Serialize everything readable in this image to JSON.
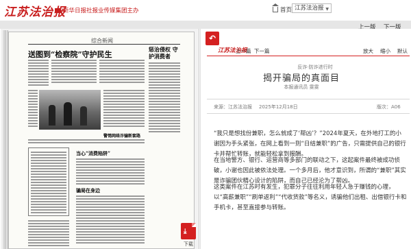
{
  "brand": {
    "logo": "江苏法治报",
    "tagline": "新华日报社报业传媒集团主办"
  },
  "header": {
    "home_label": "首页",
    "edition_value": "江苏法治报"
  },
  "pager": {
    "prev_label": "上一版",
    "next_label": "下一版"
  },
  "newspaper": {
    "page_tag": "综合新闻",
    "headline_main": "送图到“检察院”守护民生",
    "headline_right": "惩治侵权 守护消费者",
    "headline_mid": "当心“消费陷阱”",
    "headline_low": "警惕网络诈骗新套路",
    "headline_bottom": "骗局在身边"
  },
  "pdf": {
    "icon": "pdf-icon",
    "label": "下载"
  },
  "article": {
    "back_icon": "back-arrow-icon",
    "logo": "江苏法治报",
    "nav_prev": "上一篇",
    "nav_next": "下一篇",
    "font_enlarge": "放大",
    "font_shrink": "缩小",
    "font_default": "默认",
    "kicker": "反诈·防诈进行时",
    "title": "揭开骗局的真面目",
    "byline": "本报通讯员 雯雯",
    "source": "来源：江苏法治报",
    "date": "2025年12月18日",
    "page": "版次：A06",
    "paragraphs": [
      "“我只是想找份兼职，怎么就成了‘帮凶’？”2024年夏天，在外地打工的小谢因为手头紧张，在网上看到一则“日结兼职”的广告，只需提供自己的银行卡并帮忙转账，就能轻松拿到报酬。",
      "在当地警方、银行、运营商等多部门的联动之下，这起案件最终被成功侦破，小谢也因此被依法处理。一个多月后，他才意识到，所谓的“兼职”其实是诈骗团伙精心设计的陷阱，而自己已经沦为了帮凶。",
      "这类案件在江苏时有发生，犯罪分子往往利用年轻人急于赚钱的心理，以“高薪兼职”“刷单返利”“代收货款”等名义，诱骗他们出租、出借银行卡和手机卡，甚至直接参与转账。"
    ]
  }
}
